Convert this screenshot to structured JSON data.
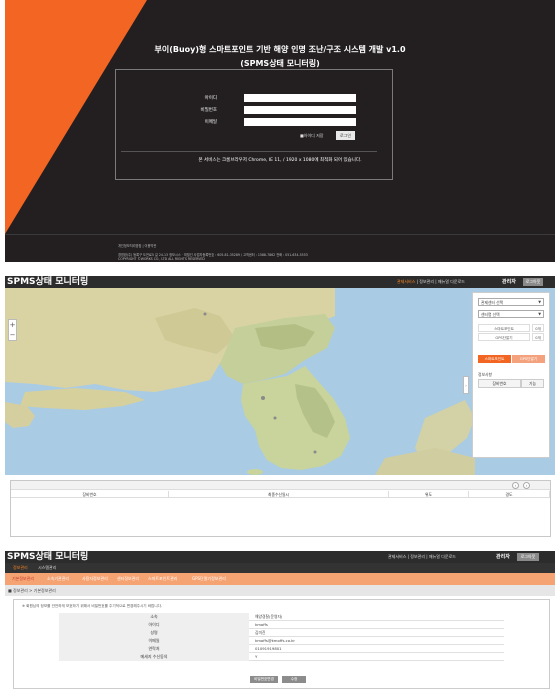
{
  "login": {
    "title_line1": "부이(Buoy)형 스마트포인트 기반 해양 인명 조난/구조 시스템 개발 v1.0",
    "title_line2": "(SPMS상태 모니터링)",
    "fields": [
      {
        "label": "아이디"
      },
      {
        "label": "비밀번호"
      },
      {
        "label": "이메일"
      }
    ],
    "remember_label": "■아이디 저장",
    "login_button": "로그인",
    "notice": "본 서비스는 크롬브라우저 Chrome, IE 11, / 1920 x 1080에 최적화 되어 있습니다.",
    "footer_links": "개인정보처리방침 | 이용약관",
    "footer_address": "경영환(주) 등록구 도전로5 길 24-13 정보시스 · 최필선 사업자등록번호 : 605-81-35289 / 고객센터 : 1588-7862 전화 : 051-634-5553",
    "footer_copyright": "COPYRIGHT ©WORKS CO., LTD ALL RIGHTS RESERVED"
  },
  "header": {
    "logo": "SPMS상태 모니터링",
    "nav_active": "관제서비스",
    "nav_rest": "| 정보관리 | 매뉴얼 다운로드",
    "admin": "관리자",
    "logout": "로그아웃"
  },
  "map_panel": {
    "zoom_in": "+",
    "zoom_out": "−",
    "collapse": "›",
    "dropdown1": "관제센터 선택",
    "dropdown2": "센터명 선택",
    "stats": [
      {
        "label": "스마트포인트",
        "value": "0개"
      },
      {
        "label": "GPS단말기",
        "value": "0개"
      }
    ],
    "tab_active": "스마트포인트",
    "tab_inactive": "GPS단말기",
    "list_label": "정보사항",
    "list_headers": [
      "장비번호",
      "기능"
    ],
    "table_headers": [
      "장비번호",
      "최종수신일시",
      "위도",
      "경도"
    ],
    "prev": "‹",
    "next": "›"
  },
  "user_panel": {
    "subnav_active": "정보관리",
    "subnav_other": "시스템관리",
    "menu": [
      "기본정보관리",
      "소속기관관리",
      "사용자정보관리",
      "센터정보관리",
      "스마트포인트관리",
      "GPS단말기정보관리"
    ],
    "breadcrumb": "■ 정보관리 > 기본정보관리",
    "note": "※ 회원님의 정보를 안전하게 보호하기 위해서 비밀번호를 주기적으로 변경해주시기 바랍니다.",
    "fields": [
      {
        "label": "소속",
        "value": "해양경찰(운영자)"
      },
      {
        "label": "아이디",
        "value": "kmoffs"
      },
      {
        "label": "성명",
        "value": "김미진"
      },
      {
        "label": "이메일",
        "value": "kmoffs@kmoffs.co.kr"
      },
      {
        "label": "연락처",
        "value": "01091919801"
      },
      {
        "label": "메세지 수신동의",
        "value": "Y"
      }
    ],
    "btn_change_password": "비밀번호변경",
    "btn_edit": "수정"
  },
  "colors": {
    "brand_orange": "#f26522",
    "header_dark": "#2c2c2c",
    "menu_orange": "#f6a373"
  }
}
